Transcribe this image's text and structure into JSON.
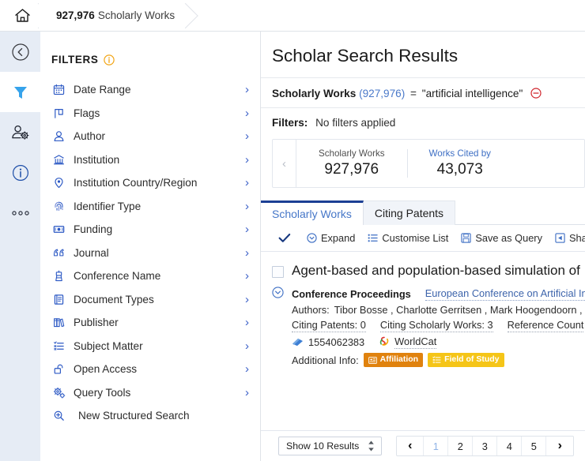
{
  "breadcrumb": {
    "home_icon": "home-icon",
    "items": [
      {
        "count": "927,976",
        "label": "Scholarly Works"
      }
    ]
  },
  "rail": {
    "items": [
      {
        "name": "collapse-panel",
        "icon": "chevron-left-circle-icon",
        "active": false
      },
      {
        "name": "filters",
        "icon": "funnel-icon",
        "active": true
      },
      {
        "name": "user-settings",
        "icon": "user-gear-icon",
        "active": false
      },
      {
        "name": "information",
        "icon": "info-circle-icon",
        "active": false
      },
      {
        "name": "more-options",
        "icon": "ellipsis-icon",
        "active": false
      }
    ]
  },
  "filters_panel": {
    "title": "FILTERS",
    "info_icon": "info-circle-icon",
    "items": [
      {
        "label": "Date Range",
        "icon": "calendar-icon",
        "chevron": true
      },
      {
        "label": "Flags",
        "icon": "flag-icon",
        "chevron": true
      },
      {
        "label": "Author",
        "icon": "person-icon",
        "chevron": true
      },
      {
        "label": "Institution",
        "icon": "bank-icon",
        "chevron": true
      },
      {
        "label": "Institution Country/Region",
        "icon": "location-pin-icon",
        "chevron": true
      },
      {
        "label": "Identifier Type",
        "icon": "fingerprint-icon",
        "chevron": true
      },
      {
        "label": "Funding",
        "icon": "banknote-icon",
        "chevron": true
      },
      {
        "label": "Journal",
        "icon": "quotes-icon",
        "chevron": true
      },
      {
        "label": "Conference Name",
        "icon": "podium-icon",
        "chevron": true
      },
      {
        "label": "Document Types",
        "icon": "book-icon",
        "chevron": true
      },
      {
        "label": "Publisher",
        "icon": "books-icon",
        "chevron": true
      },
      {
        "label": "Subject Matter",
        "icon": "list-icon",
        "chevron": true
      },
      {
        "label": "Open Access",
        "icon": "open-lock-icon",
        "chevron": true
      },
      {
        "label": "Query Tools",
        "icon": "gears-icon",
        "chevron": true
      },
      {
        "label": "New Structured Search",
        "icon": "search-plus-icon",
        "chevron": false
      }
    ]
  },
  "main": {
    "title": "Scholar Search Results",
    "query": {
      "field": "Scholarly Works",
      "count": "(927,976)",
      "operator": "=",
      "value": "\"artificial intelligence\"",
      "remove_icon": "remove-circle-icon"
    },
    "filters_row": {
      "label": "Filters:",
      "value": "No filters applied"
    },
    "stats": {
      "prev_icon": "chevron-left-icon",
      "cards": [
        {
          "label": "Scholarly Works",
          "value": "927,976",
          "is_link": false
        },
        {
          "label": "Works Cited by",
          "value": "43,073",
          "is_link": true
        }
      ]
    },
    "tabs": [
      {
        "label": "Scholarly Works",
        "active": true
      },
      {
        "label": "Citing Patents",
        "active": false
      }
    ],
    "toolbar": {
      "check_icon": "checkmark-icon",
      "items": [
        {
          "label": "Expand",
          "icon": "expand-circle-icon"
        },
        {
          "label": "Customise List",
          "icon": "list-settings-icon"
        },
        {
          "label": "Save as Query",
          "icon": "floppy-disk-icon"
        },
        {
          "label": "Share",
          "icon": "share-icon"
        }
      ]
    },
    "result": {
      "checkbox": "result-checkbox",
      "title": "Agent-based and population-based simulation of",
      "expand_icon": "chevron-down-circle-icon",
      "doc_type": "Conference Proceedings",
      "venue": "European Conference on Artificial Int",
      "authors_label": "Authors:",
      "authors": "Tibor Bosse , Charlotte Gerritsen , Mark Hoogendoorn , Sy",
      "citing_patents": "Citing Patents: 0",
      "citing_scholarly_works": "Citing Scholarly Works: 3",
      "reference_count": "Reference Count",
      "identifier_icon": "scholar-icon",
      "identifier": "1554062383",
      "worldcat_icon": "worldcat-icon",
      "worldcat": "WorldCat",
      "additional_info_label": "Additional Info:",
      "badges": [
        {
          "label": "Affiliation",
          "color": "#e0820e",
          "icon": "id-card-icon"
        },
        {
          "label": "Field of Study",
          "color": "#f5c518",
          "icon": "list-icon"
        }
      ]
    },
    "footer": {
      "show_results": "Show 10 Results",
      "stepper_icon": "up-down-arrows-icon",
      "prev_icon": "chevron-left-icon",
      "next_icon": "chevron-right-icon",
      "pages": [
        "1",
        "2",
        "3",
        "4",
        "5"
      ],
      "current_page": "1"
    }
  },
  "colors": {
    "accent_blue": "#3e6fc4",
    "rail_bg": "#e6ecf5",
    "active_tab_border": "#1c3f94",
    "badge_orange": "#e0820e",
    "badge_yellow": "#f5c518",
    "remove_red": "#d0252c",
    "amber": "#f2a516"
  }
}
